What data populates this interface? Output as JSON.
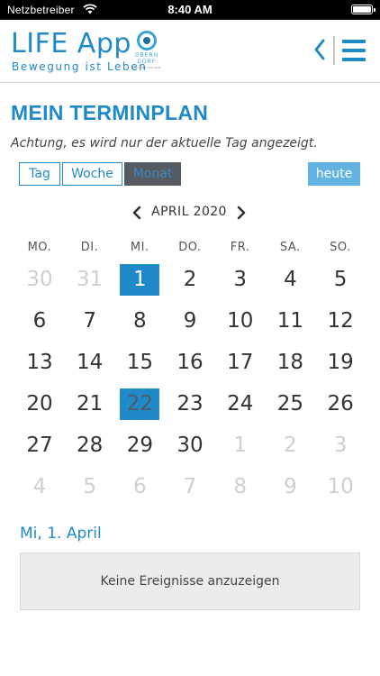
{
  "status_bar": {
    "carrier": "Netzbetreiber",
    "time": "8:40 AM",
    "wifi_icon": "wifi-icon",
    "battery_icon": "battery-full-icon"
  },
  "header": {
    "app_title": "LIFE App",
    "app_subtitle": "Bewegung ist Leben",
    "logo_text": "OBERN DORF",
    "logo_small_text": "REHABILITATION",
    "back_icon": "chevron-left-icon",
    "menu_icon": "hamburger-menu-icon",
    "accent_color": "#1f8ac7"
  },
  "page": {
    "title": "MEIN TERMINPLAN",
    "notice": "Achtung, es wird nur der aktuelle Tag angezeigt."
  },
  "view_switch": {
    "day": "Tag",
    "week": "Woche",
    "month": "Monat",
    "active": "month",
    "today": "heute"
  },
  "calendar": {
    "month_label": "APRIL 2020",
    "prev_icon": "chevron-left-icon",
    "next_icon": "chevron-right-icon",
    "weekdays": [
      "MO.",
      "DI.",
      "MI.",
      "DO.",
      "FR.",
      "SA.",
      "SO."
    ],
    "weeks": [
      [
        "30",
        "31",
        "1",
        "2",
        "3",
        "4",
        "5"
      ],
      [
        "6",
        "7",
        "8",
        "9",
        "10",
        "11",
        "12"
      ],
      [
        "13",
        "14",
        "15",
        "16",
        "17",
        "18",
        "19"
      ],
      [
        "20",
        "21",
        "22",
        "23",
        "24",
        "25",
        "26"
      ],
      [
        "27",
        "28",
        "29",
        "30",
        "1",
        "2",
        "3"
      ],
      [
        "4",
        "5",
        "6",
        "7",
        "8",
        "9",
        "10"
      ]
    ],
    "selected_day": "1",
    "today_day": "22"
  },
  "events": {
    "date_heading": "Mi, 1. April",
    "empty_text": "Keine Ereignisse anzuzeigen"
  }
}
